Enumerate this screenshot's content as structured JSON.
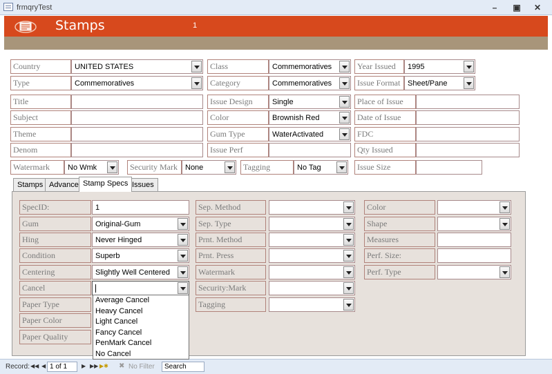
{
  "window": {
    "title": "frmqryTest"
  },
  "header": {
    "title": "Stamps",
    "number": "1"
  },
  "fields": {
    "country": {
      "label": "Country",
      "value": "UNITED STATES"
    },
    "class": {
      "label": "Class",
      "value": "Commemoratives"
    },
    "year_issued": {
      "label": "Year Issued",
      "value": "1995"
    },
    "type": {
      "label": "Type",
      "value": "Commemoratives"
    },
    "category": {
      "label": "Category",
      "value": "Commemoratives"
    },
    "issue_format": {
      "label": "Issue Format",
      "value": "Sheet/Pane"
    },
    "title": {
      "label": "Title",
      "value": ""
    },
    "issue_design": {
      "label": "Issue Design",
      "value": "Single"
    },
    "place_of_issue": {
      "label": "Place of Issue",
      "value": ""
    },
    "subject": {
      "label": "Subject",
      "value": ""
    },
    "color": {
      "label": "Color",
      "value": "Brownish Red"
    },
    "date_of_issue": {
      "label": "Date of Issue",
      "value": ""
    },
    "theme": {
      "label": "Theme",
      "value": ""
    },
    "gum_type": {
      "label": "Gum Type",
      "value": "WaterActivated"
    },
    "fdc": {
      "label": "FDC",
      "value": ""
    },
    "denom": {
      "label": "Denom",
      "value": ""
    },
    "issue_perf": {
      "label": "Issue Perf",
      "value": ""
    },
    "qty_issued": {
      "label": "Qty Issued",
      "value": ""
    },
    "watermark": {
      "label": "Watermark",
      "value": "No Wmk"
    },
    "security_mark": {
      "label": "Security Mark",
      "value": "None"
    },
    "tagging": {
      "label": "Tagging",
      "value": "No Tag"
    },
    "issue_size": {
      "label": "Issue Size",
      "value": ""
    }
  },
  "tabs": [
    {
      "label": "Stamps"
    },
    {
      "label": "Advance"
    },
    {
      "label": "Stamp Specs"
    },
    {
      "label": "Issues"
    }
  ],
  "specs": {
    "spec_id": {
      "label": "SpecID:",
      "value": "1"
    },
    "gum": {
      "label": "Gum",
      "value": "Original-Gum"
    },
    "hing": {
      "label": "Hing",
      "value": "Never Hinged"
    },
    "condition": {
      "label": "Condition",
      "value": "Superb"
    },
    "centering": {
      "label": "Centering",
      "value": "Slightly Well Centered"
    },
    "cancel": {
      "label": "Cancel",
      "value": ""
    },
    "paper_type": {
      "label": "Paper Type"
    },
    "paper_color": {
      "label": "Paper Color"
    },
    "paper_quality": {
      "label": "Paper Quality"
    },
    "sep_method": {
      "label": "Sep. Method",
      "value": ""
    },
    "sep_type": {
      "label": "Sep. Type",
      "value": ""
    },
    "prnt_method": {
      "label": "Prnt. Method",
      "value": ""
    },
    "prnt_press": {
      "label": "Prnt. Press",
      "value": ""
    },
    "s_watermark": {
      "label": "Watermark",
      "value": ""
    },
    "security_mark": {
      "label": "Security:Mark",
      "value": ""
    },
    "s_tagging": {
      "label": "Tagging",
      "value": ""
    },
    "s_color": {
      "label": "Color",
      "value": ""
    },
    "shape": {
      "label": "Shape",
      "value": ""
    },
    "measures": {
      "label": "Measures",
      "value": ""
    },
    "perf_size": {
      "label": "Perf. Size:",
      "value": ""
    },
    "perf_type": {
      "label": "Perf. Type",
      "value": ""
    }
  },
  "cancel_options": [
    "Average Cancel",
    "Heavy Cancel",
    "Light Cancel",
    "Fancy Cancel",
    "PenMark Cancel",
    "No Cancel"
  ],
  "navbar": {
    "record_label": "Record:",
    "position": "1 of 1",
    "filter": "No Filter",
    "search": "Search"
  },
  "colors": {
    "header": "#d7491d",
    "band": "#a8957a",
    "label_border": "#b0827a",
    "tab_page": "#e7e1dc"
  }
}
